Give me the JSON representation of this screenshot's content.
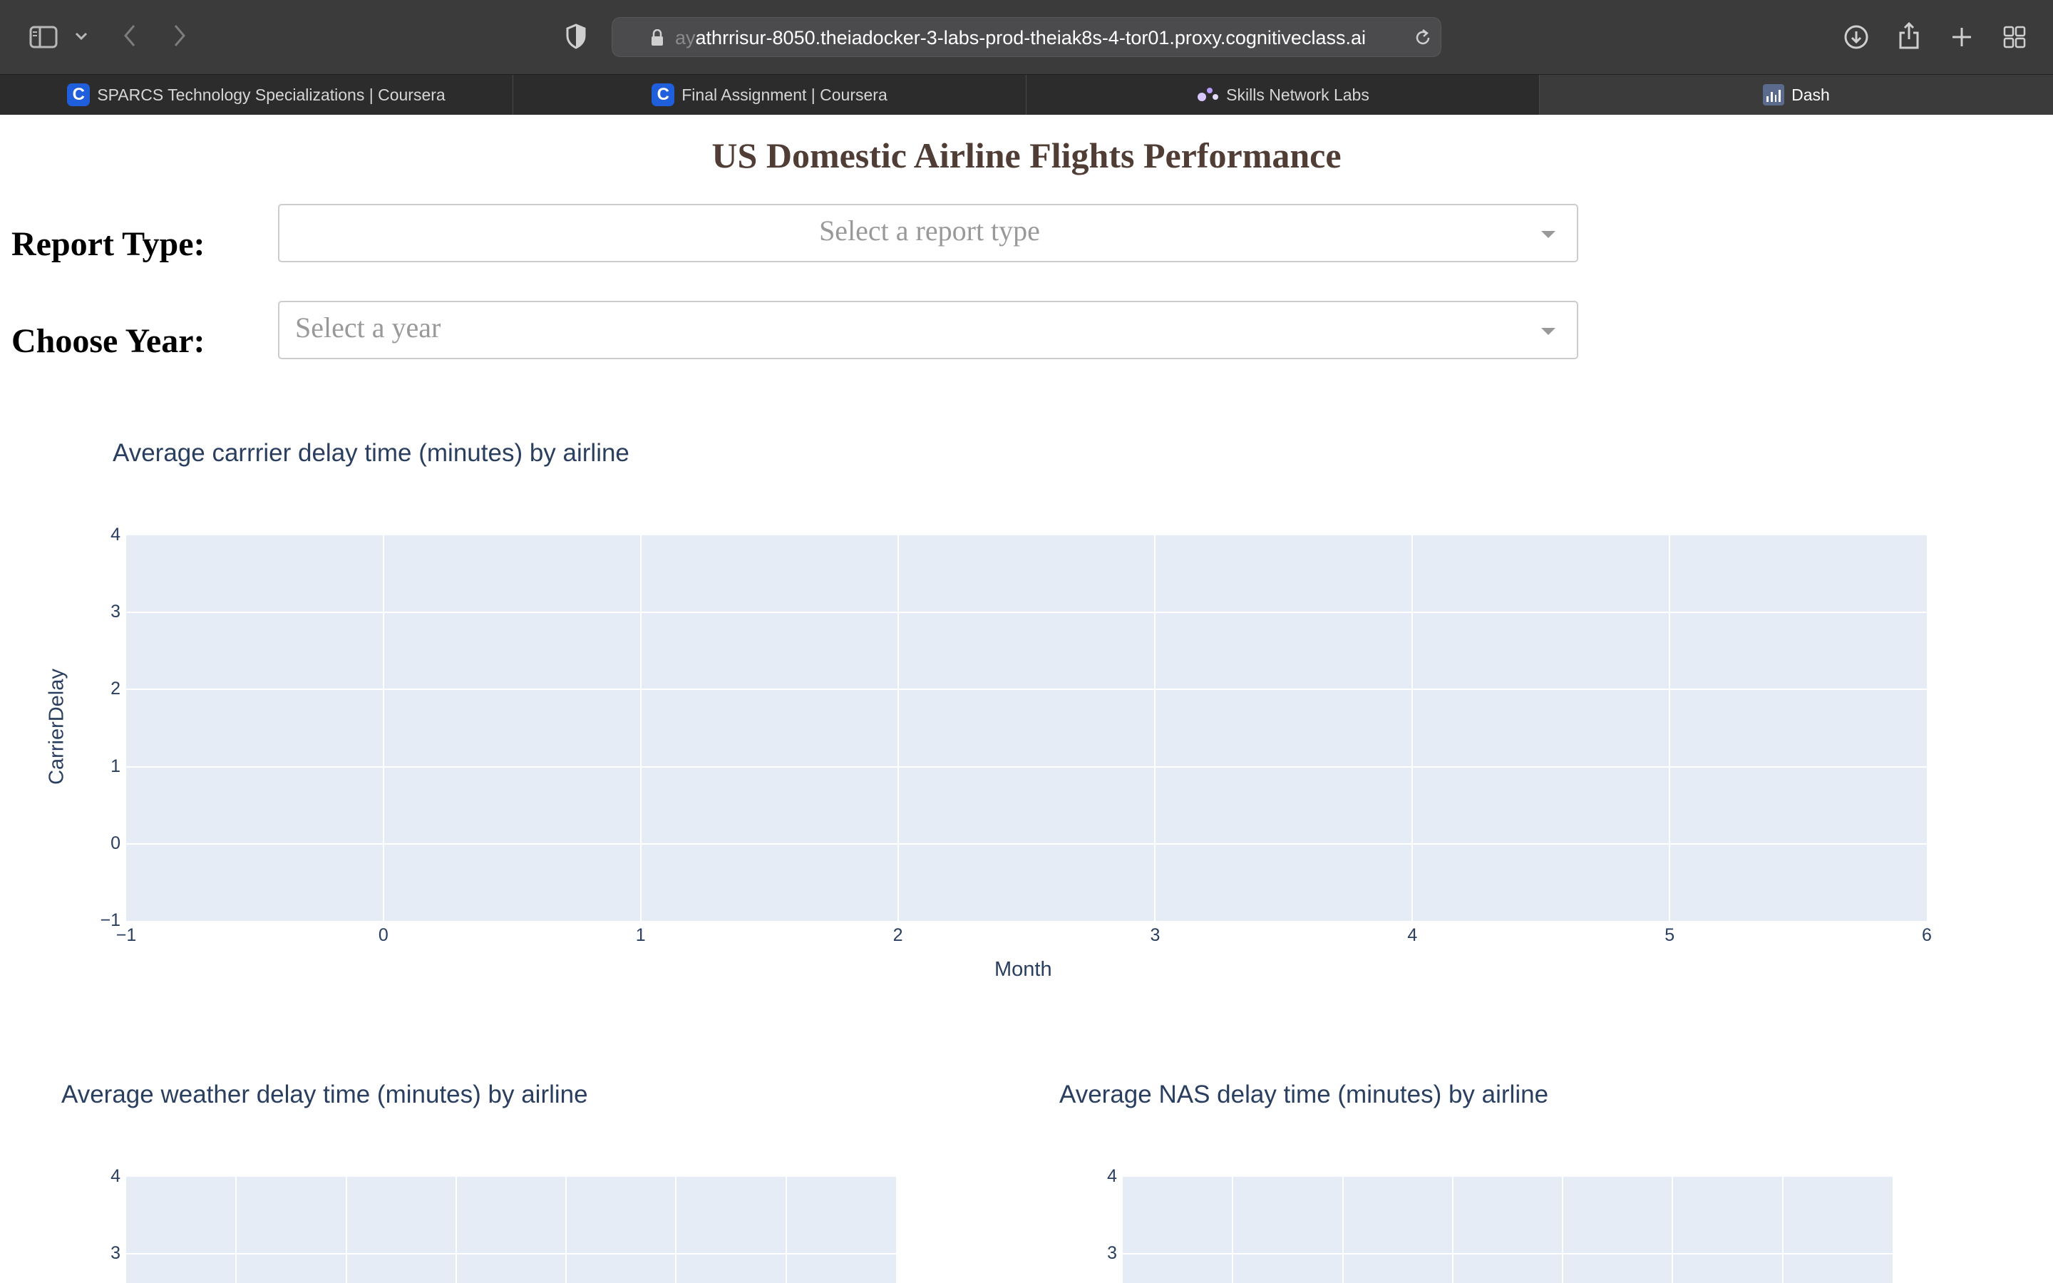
{
  "browser": {
    "url_prefix": "ay",
    "url_main": "athrrisur-8050.theiadocker-3-labs-prod-theiak8s-4-tor01.proxy.cognitiveclass.ai",
    "tabs": [
      {
        "label": "SPARCS Technology Specializations | Coursera",
        "icon": "coursera-icon",
        "active": false
      },
      {
        "label": "Final Assignment | Coursera",
        "icon": "coursera-icon",
        "active": false
      },
      {
        "label": "Skills Network Labs",
        "icon": "skills-network-icon",
        "active": false
      },
      {
        "label": "Dash",
        "icon": "dash-icon",
        "active": true
      }
    ]
  },
  "page": {
    "title": "US Domestic Airline Flights Performance",
    "report_type": {
      "label": "Report Type:",
      "placeholder": "Select a report type"
    },
    "year": {
      "label": "Choose Year:",
      "placeholder": "Select a year"
    }
  },
  "colors": {
    "title": "#503D36",
    "plot_background": "#e5ecf6",
    "axis_text": "#2a3f5f",
    "browser_toolbar": "#3b3b3c"
  },
  "chart_data": [
    {
      "type": "line",
      "title": "Average carrrier delay time (minutes) by airline",
      "xlabel": "Month",
      "ylabel": "CarrierDelay",
      "xlim": [
        -1,
        6
      ],
      "ylim": [
        -1,
        4
      ],
      "x_ticks": [
        "−1",
        "0",
        "1",
        "2",
        "3",
        "4",
        "5",
        "6"
      ],
      "y_ticks": [
        "−1",
        "0",
        "1",
        "2",
        "3",
        "4"
      ],
      "series": [],
      "grid": true
    },
    {
      "type": "line",
      "title": "Average weather delay time (minutes) by airline",
      "y_ticks_visible": [
        "3",
        "4"
      ],
      "series": [],
      "grid": true
    },
    {
      "type": "line",
      "title": "Average NAS delay time (minutes) by airline",
      "y_ticks_visible": [
        "3",
        "4"
      ],
      "series": [],
      "grid": true
    }
  ]
}
